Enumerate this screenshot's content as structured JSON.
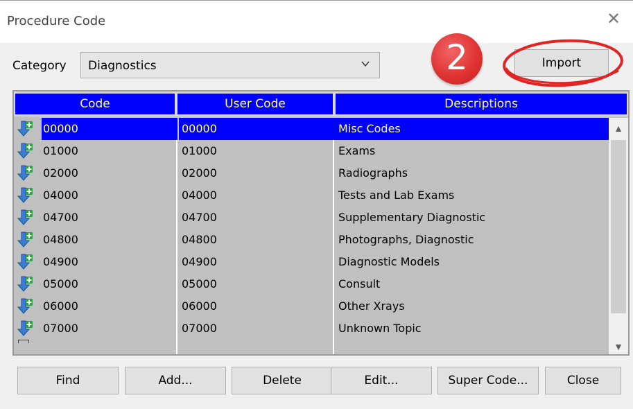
{
  "window": {
    "title": "Procedure Code",
    "close_glyph": "✕"
  },
  "category": {
    "label": "Category",
    "value": "Diagnostics",
    "dropdown_icon": "chevron-down-icon"
  },
  "annotation": {
    "step_number": "2",
    "color": "#e03434"
  },
  "import_button": "Import",
  "grid": {
    "headers": [
      "Code",
      "User Code",
      "Descriptions"
    ],
    "header_bg": "#0000ff",
    "header_fg": "#ffff66",
    "row_icon": "add-arrow-icon",
    "selected_index": 0,
    "rows": [
      {
        "code": "00000",
        "user_code": "00000",
        "description": "Misc Codes"
      },
      {
        "code": "01000",
        "user_code": "01000",
        "description": "Exams"
      },
      {
        "code": "02000",
        "user_code": "02000",
        "description": "Radiographs"
      },
      {
        "code": "04000",
        "user_code": "04000",
        "description": "Tests and Lab Exams"
      },
      {
        "code": "04700",
        "user_code": "04700",
        "description": "Supplementary Diagnostic"
      },
      {
        "code": "04800",
        "user_code": "04800",
        "description": "Photographs, Diagnostic"
      },
      {
        "code": "04900",
        "user_code": "04900",
        "description": "Diagnostic Models"
      },
      {
        "code": "05000",
        "user_code": "05000",
        "description": "Consult"
      },
      {
        "code": "06000",
        "user_code": "06000",
        "description": "Other Xrays"
      },
      {
        "code": "07000",
        "user_code": "07000",
        "description": "Unknown Topic"
      }
    ]
  },
  "buttons": {
    "find": "Find",
    "add": "Add...",
    "delete": "Delete",
    "edit": "Edit...",
    "super_code": "Super Code...",
    "close": "Close"
  }
}
